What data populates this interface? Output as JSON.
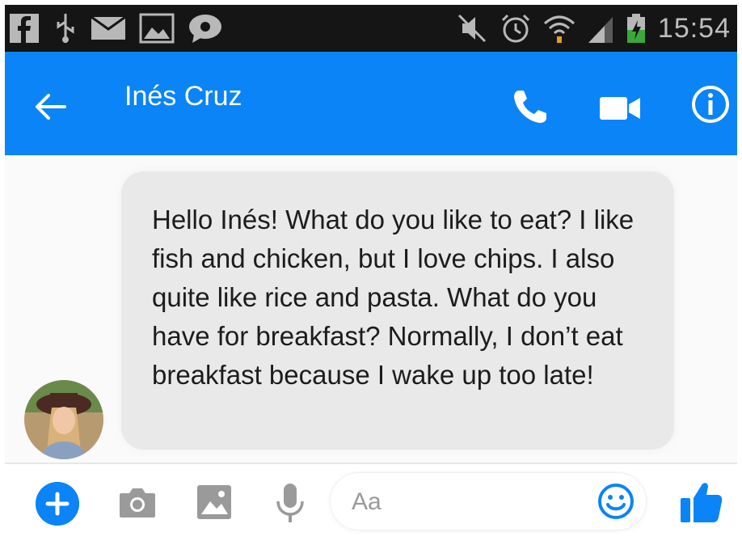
{
  "status_bar": {
    "time": "15:54",
    "left_icons": [
      "facebook-icon",
      "usb-icon",
      "mail-icon",
      "gallery-icon",
      "chat-bubble-icon"
    ],
    "right_icons": [
      "mute-icon",
      "alarm-icon",
      "wifi-icon",
      "signal-icon",
      "battery-charging-icon"
    ]
  },
  "header": {
    "contact_name": "Inés Cruz",
    "actions": [
      "back-arrow-icon",
      "phone-icon",
      "video-camera-icon",
      "info-icon"
    ]
  },
  "conversation": {
    "messages": [
      {
        "from": "Inés Cruz",
        "text": "Hello Inés! What do you like to eat? I like fish and chicken, but I love chips. I also quite like rice and pasta. What do you have for breakfast? Normally, I don’t eat breakfast because I wake up too late!"
      }
    ]
  },
  "composer": {
    "placeholder": "Aa",
    "value": "",
    "buttons": [
      "plus-icon",
      "camera-icon",
      "image-icon",
      "microphone-icon",
      "emoji-icon",
      "thumbs-up-icon"
    ]
  },
  "colors": {
    "brand_blue": "#0a84f7",
    "status_bar_bg": "#151515",
    "bubble_bg": "#e9e9e9"
  }
}
